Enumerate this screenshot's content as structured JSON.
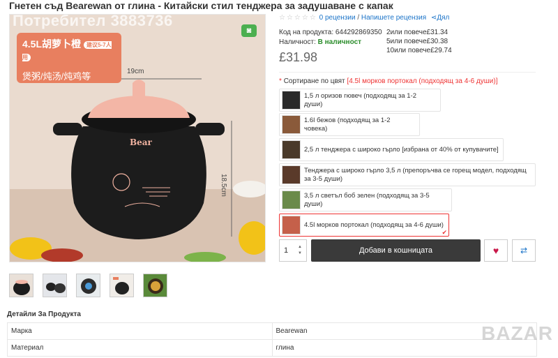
{
  "product": {
    "title": "Гнетен съд Bearewan от глина - Китайски стил тенджера за задушаване с капак",
    "rating": {
      "stars": "☆☆☆☆☆",
      "reviews_link": "0 рецензии",
      "separator": "/",
      "write_review_link": "Напишете рецензия",
      "share_label": "Дял"
    },
    "code_label": "Код на продукта:",
    "code": "644292869350",
    "availability_label": "Наличност:",
    "availability": "В наличност",
    "price": "£31.98",
    "qty_prices": [
      {
        "qty": "2или повече",
        "price": "£31.34"
      },
      {
        "qty": "5или повече",
        "price": "£30.38"
      },
      {
        "qty": "10или повече",
        "price": "£29.74"
      }
    ]
  },
  "image": {
    "watermark": "Потребител 3883736",
    "promo_title": "4.5L胡萝卜橙",
    "promo_badge": "建议5-7人用",
    "promo_sub": "煲粥/炖汤/炖鸡等",
    "width_label": "19cm",
    "height_label": "18.5cm",
    "brand_on_pot": "Bear"
  },
  "color_sort": {
    "required_mark": "*",
    "label": "Сортиране по цвят",
    "selected_text": "[4.5l морков портокал (подходящ за 4-6 души)]",
    "options": [
      {
        "label": "1,5 л оризов гювеч (подходящ за 1-2 души)"
      },
      {
        "label": "1.6l бежов (подходящ за 1-2 човека)"
      },
      {
        "label": "2,5 л тенджера с широко гърло [избрана от 40% от купувачите]"
      },
      {
        "label": "Тенджера с широко гърло 3,5 л (препоръчва се горещ модел, подходящ за 3-5 души)"
      },
      {
        "label": "3,5 л светъл боб зелен (подходящ за 3-5 души)"
      },
      {
        "label": "4.5l морков портокал (подходящ за 4-6 души)"
      }
    ]
  },
  "cart": {
    "qty_value": "1",
    "add_button": "Добави в кошницата"
  },
  "details": {
    "title": "Детайли За Продукта",
    "rows": [
      {
        "key": "Марка",
        "value": "Bearewan"
      },
      {
        "key": "Материал",
        "value": "глина"
      }
    ]
  },
  "site_watermark": "BAZAR",
  "colors": {
    "accent_dark": "#3a3a3a",
    "price_text": "#666666",
    "link": "#1a73c8",
    "in_stock": "#2a8c2a",
    "required": "#e33333",
    "promo": "#e87f5f"
  },
  "icons": [
    "camera-icon",
    "star-icon",
    "share-icon",
    "heart-icon",
    "compare-icon",
    "chevron-up-icon",
    "chevron-down-icon"
  ]
}
